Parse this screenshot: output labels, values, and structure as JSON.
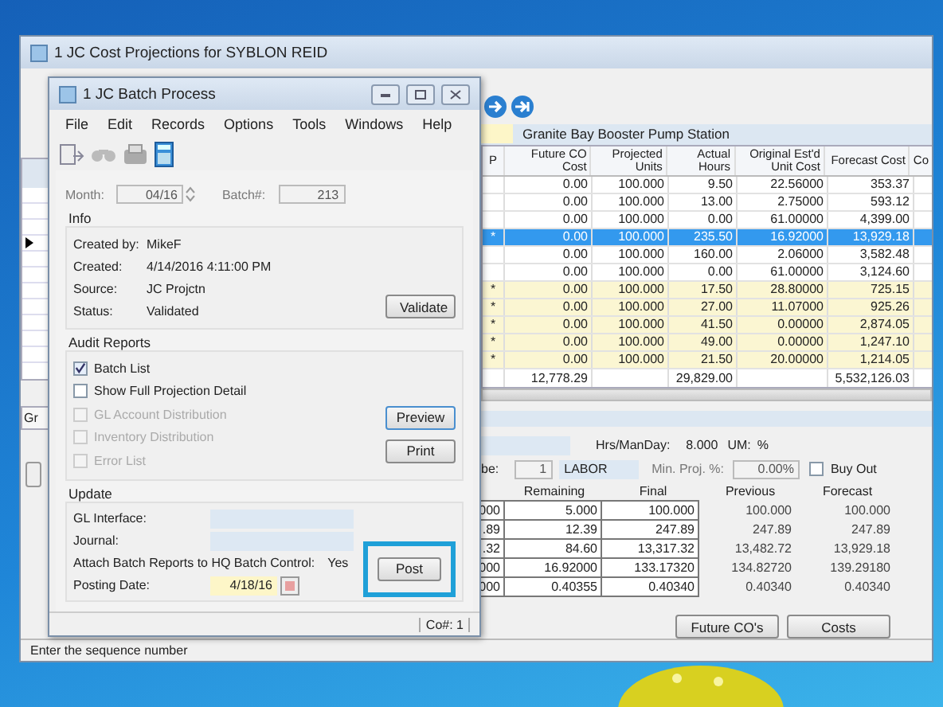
{
  "back_window": {
    "title": "1 JC Cost Projections for SYBLON REID",
    "description": "Granite Bay Booster Pump Station",
    "table": {
      "p_column": "P",
      "columns": [
        "Future CO Cost",
        "Projected Units",
        "Actual Hours",
        "Original Est'd Unit Cost",
        "Forecast Cost",
        "Co"
      ],
      "rows": [
        {
          "cells": [
            "0.00",
            "100.000",
            "9.50",
            "22.56000",
            "353.37"
          ],
          "selected": false,
          "highlighted": false
        },
        {
          "cells": [
            "0.00",
            "100.000",
            "13.00",
            "2.75000",
            "593.12"
          ],
          "selected": false,
          "highlighted": false
        },
        {
          "cells": [
            "0.00",
            "100.000",
            "0.00",
            "61.00000",
            "4,399.00"
          ],
          "selected": false,
          "highlighted": false
        },
        {
          "p": "*",
          "cells": [
            "0.00",
            "100.000",
            "235.50",
            "16.92000",
            "13,929.18"
          ],
          "selected": true,
          "highlighted": false
        },
        {
          "cells": [
            "0.00",
            "100.000",
            "160.00",
            "2.06000",
            "3,582.48"
          ],
          "selected": false,
          "highlighted": false
        },
        {
          "cells": [
            "0.00",
            "100.000",
            "0.00",
            "61.00000",
            "3,124.60"
          ],
          "selected": false,
          "highlighted": false
        },
        {
          "p": "*",
          "cells": [
            "0.00",
            "100.000",
            "17.50",
            "28.80000",
            "725.15"
          ],
          "selected": false,
          "highlighted": true
        },
        {
          "p": "*",
          "cells": [
            "0.00",
            "100.000",
            "27.00",
            "11.07000",
            "925.26"
          ],
          "selected": false,
          "highlighted": true
        },
        {
          "p": "*",
          "cells": [
            "0.00",
            "100.000",
            "41.50",
            "0.00000",
            "2,874.05"
          ],
          "selected": false,
          "highlighted": true
        },
        {
          "p": "*",
          "cells": [
            "0.00",
            "100.000",
            "49.00",
            "0.00000",
            "1,247.10"
          ],
          "selected": false,
          "highlighted": true
        },
        {
          "p": "*",
          "cells": [
            "0.00",
            "100.000",
            "21.50",
            "20.00000",
            "1,214.05"
          ],
          "selected": false,
          "highlighted": true
        }
      ],
      "totals": {
        "future_co_cost": "12,778.29",
        "actual_hours": "29,829.00",
        "forecast_cost": "5,532,126.03"
      }
    },
    "side_tab": "Gr",
    "details": {
      "hrs_label": "Hrs/ManDay:",
      "hrs_value": "8.000",
      "um_label": "UM:",
      "um_value": "%",
      "phase_label": "be:",
      "phase_number": "1",
      "phase_name": "LABOR",
      "min_proj_label": "Min. Proj. %:",
      "min_proj_value": "0.00%",
      "buy_out": {
        "label": "Buy Out",
        "checked": false
      },
      "column_headers": [
        "Remaining",
        "Final",
        "Previous",
        "Forecast"
      ],
      "rows": [
        {
          "column_1": "000",
          "values": [
            "5.000",
            "100.000",
            "100.000",
            "100.000"
          ]
        },
        {
          "column_1": ".89",
          "values": [
            "12.39",
            "247.89",
            "247.89",
            "247.89"
          ]
        },
        {
          "column_1": ".32",
          "values": [
            "84.60",
            "13,317.32",
            "13,482.72",
            "13,929.18"
          ]
        },
        {
          "column_1": "000",
          "values": [
            "16.92000",
            "133.17320",
            "134.82720",
            "139.29180"
          ]
        },
        {
          "column_1": "000",
          "values": [
            "0.40355",
            "0.40340",
            "0.40340",
            "0.40340"
          ]
        }
      ]
    },
    "buttons": [
      "Future CO's",
      "Costs"
    ],
    "status_bar": "Enter the sequence number"
  },
  "dialog": {
    "title": "1 JC Batch Process",
    "menu": [
      "File",
      "Edit",
      "Records",
      "Options",
      "Tools",
      "Windows",
      "Help"
    ],
    "month": {
      "label": "Month:",
      "value": "04/16"
    },
    "batch": {
      "label": "Batch#:",
      "value": "213"
    },
    "info": {
      "title": "Info",
      "fields": [
        {
          "label": "Created by:",
          "value": "MikeF"
        },
        {
          "label": "Created:",
          "value": "4/14/2016 4:11:00 PM"
        },
        {
          "label": "Source:",
          "value": "JC Projctn"
        },
        {
          "label": "Status:",
          "value": "Validated"
        }
      ]
    },
    "validate_button": "Validate",
    "audit": {
      "title": "Audit Reports",
      "options": [
        {
          "label": "Batch List",
          "checked": true,
          "disabled": false
        },
        {
          "label": "Show Full Projection Detail",
          "checked": false,
          "disabled": false
        },
        {
          "label": "GL Account Distribution",
          "checked": false,
          "disabled": true
        },
        {
          "label": "Inventory Distribution",
          "checked": false,
          "disabled": true
        },
        {
          "label": "Error List",
          "checked": false,
          "disabled": true
        }
      ]
    },
    "preview_button": "Preview",
    "print_button": "Print",
    "update": {
      "title": "Update",
      "fields": [
        {
          "label": "GL Interface:"
        },
        {
          "label": "Journal:"
        }
      ],
      "attach_label": "Attach Batch Reports to HQ Batch Control:",
      "attach_value": "Yes",
      "posting_date": {
        "label": "Posting Date:",
        "value": "4/18/16"
      }
    },
    "post_button": {
      "label": "Post",
      "highlighted": true
    },
    "status": "Co#: 1"
  }
}
